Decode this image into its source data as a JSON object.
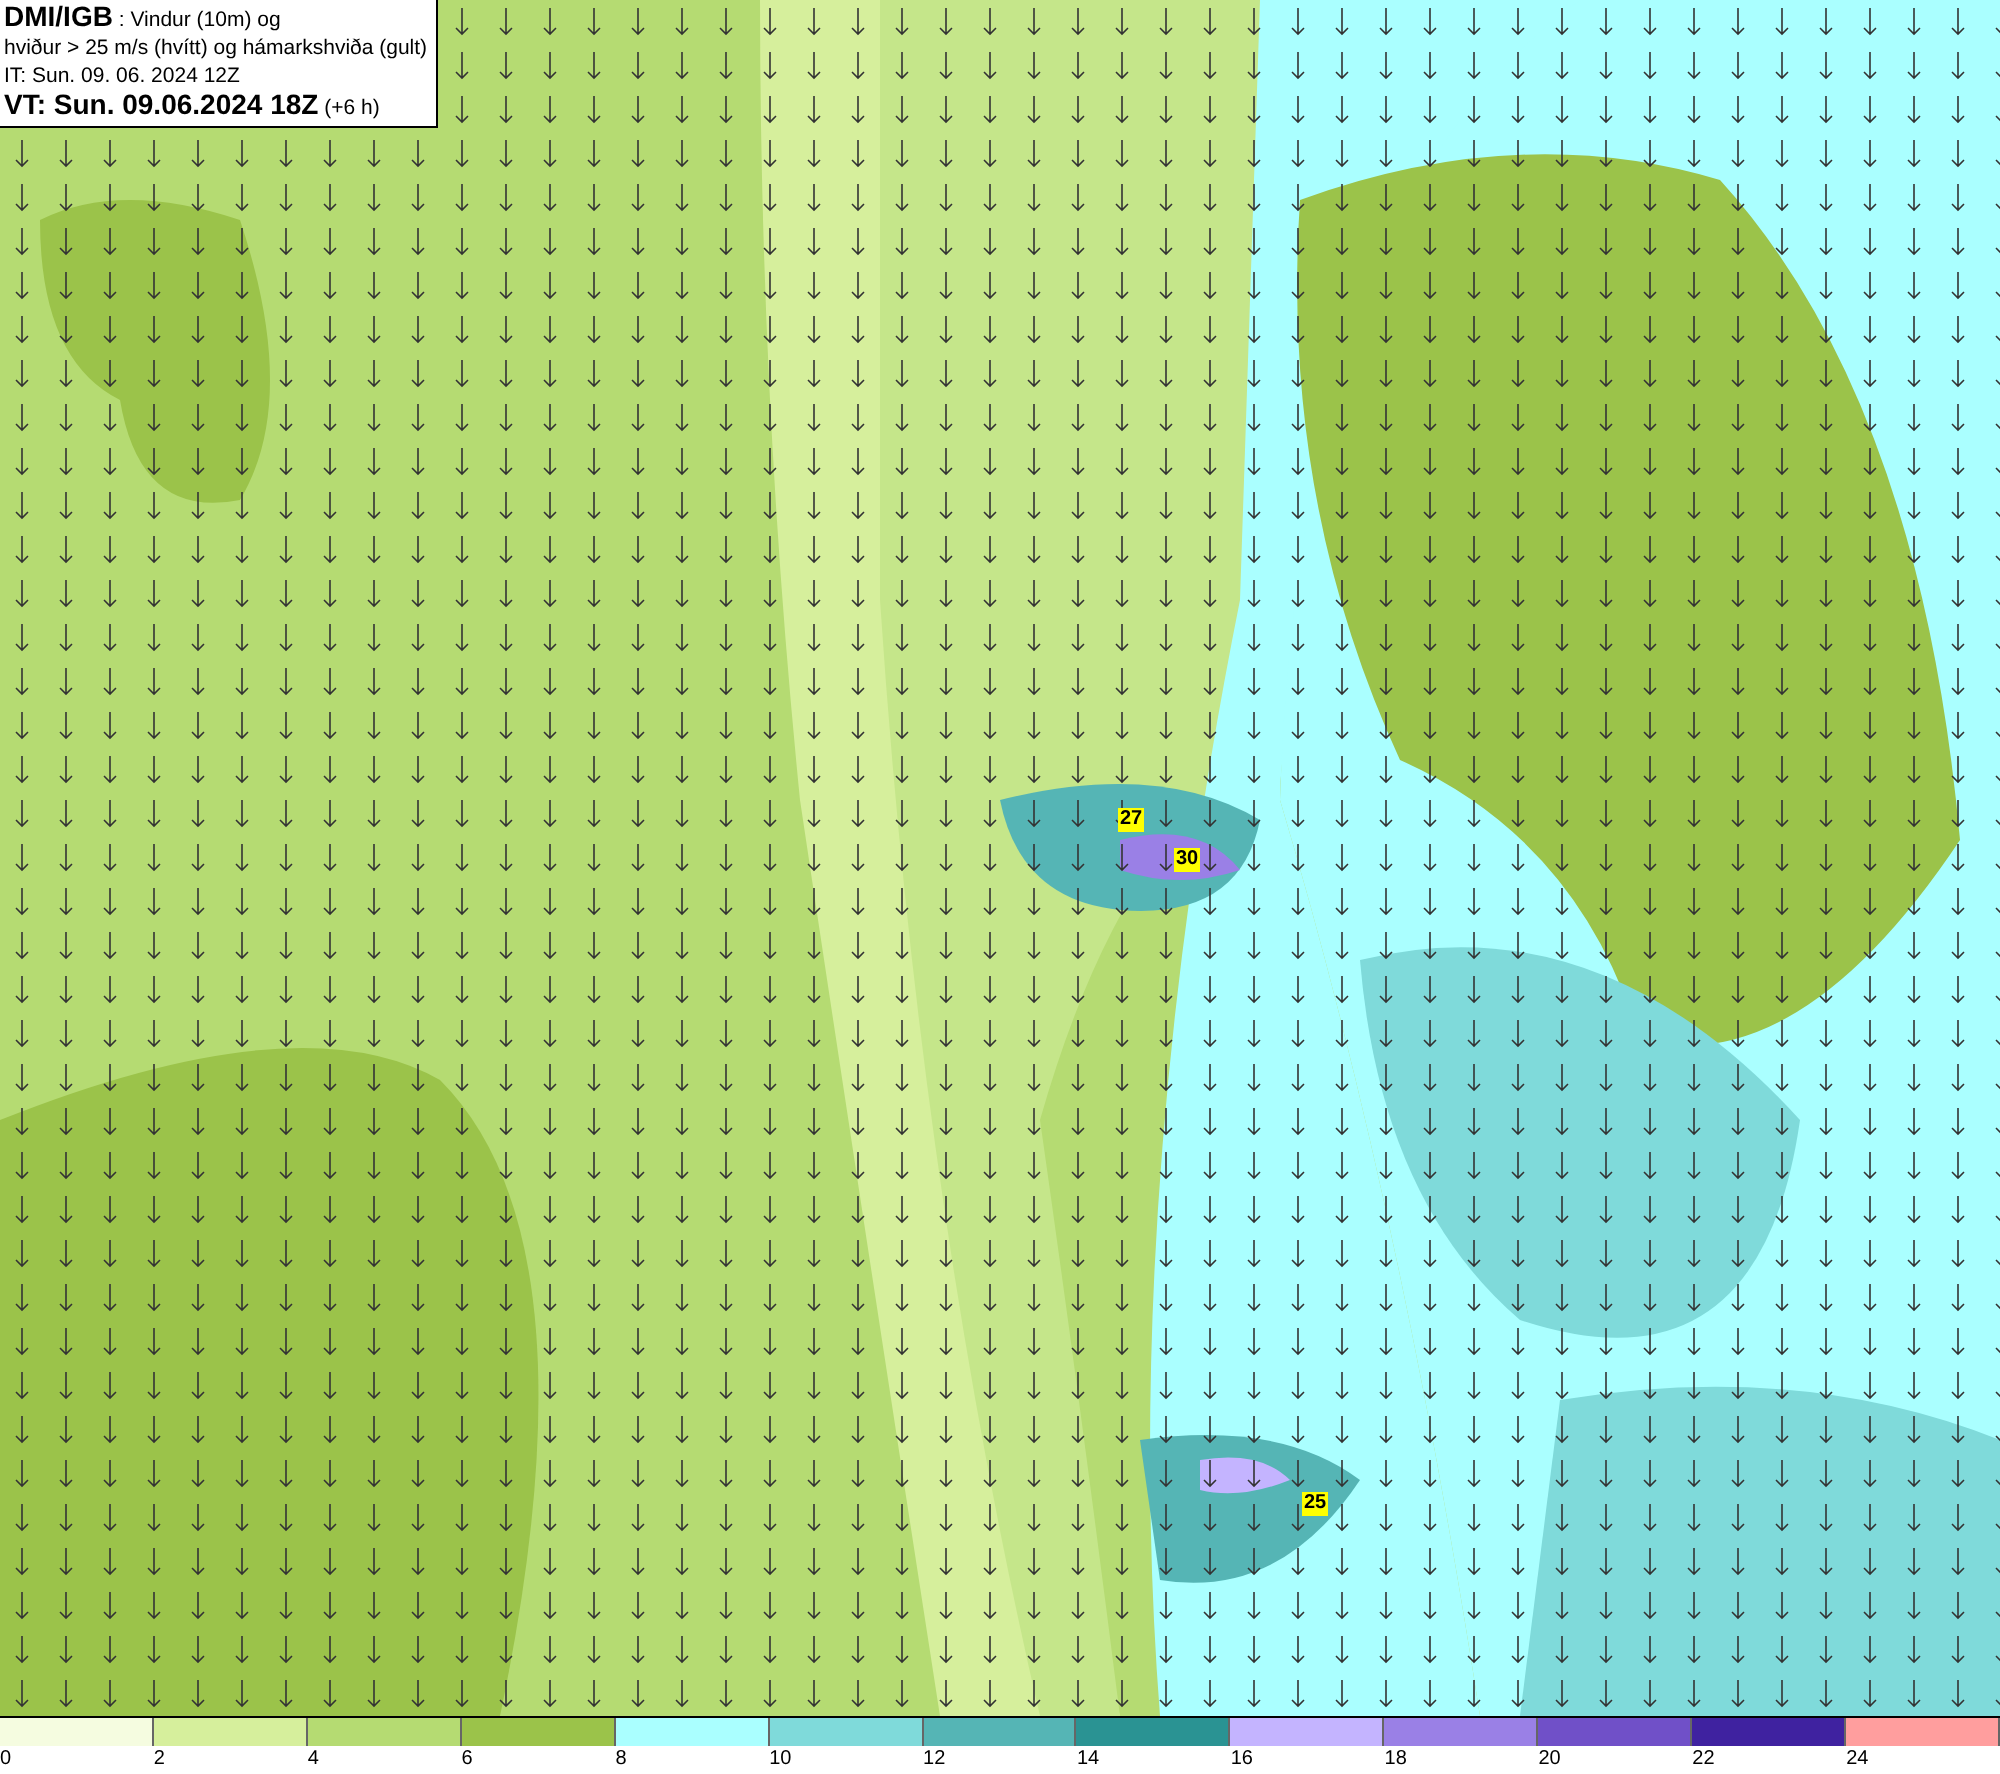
{
  "header": {
    "lines": [
      "**DMI/IGB** : Vindur (10m) og",
      "hviður > 25 m/s (hvítt) og hámarkshviða (gult)",
      "IT: Sun. 09. 06. 2024 12Z",
      "**VT: Sun. 09.06.2024 18Z** (+6 h)"
    ]
  },
  "gust_labels": [
    "27",
    "30",
    "25"
  ],
  "legend": {
    "bins": [
      {
        "color": "#f5fce0"
      },
      {
        "color": "#d6ef9c"
      },
      {
        "color": "#b5db72"
      },
      {
        "color": "#9bc34a"
      },
      {
        "color": "#aaffff"
      },
      {
        "color": "#7fdada"
      },
      {
        "color": "#55b5b5"
      },
      {
        "color": "#2a9393"
      },
      {
        "color": "#c4b4ff"
      },
      {
        "color": "#9a80e6"
      },
      {
        "color": "#7050c8"
      },
      {
        "color": "#3f22a0"
      },
      {
        "color": "#ff9e9e"
      }
    ],
    "ticks": [
      "0",
      "2",
      "4",
      "6",
      "8",
      "10",
      "12",
      "14",
      "16",
      "18",
      "20",
      "22",
      "24"
    ]
  }
}
